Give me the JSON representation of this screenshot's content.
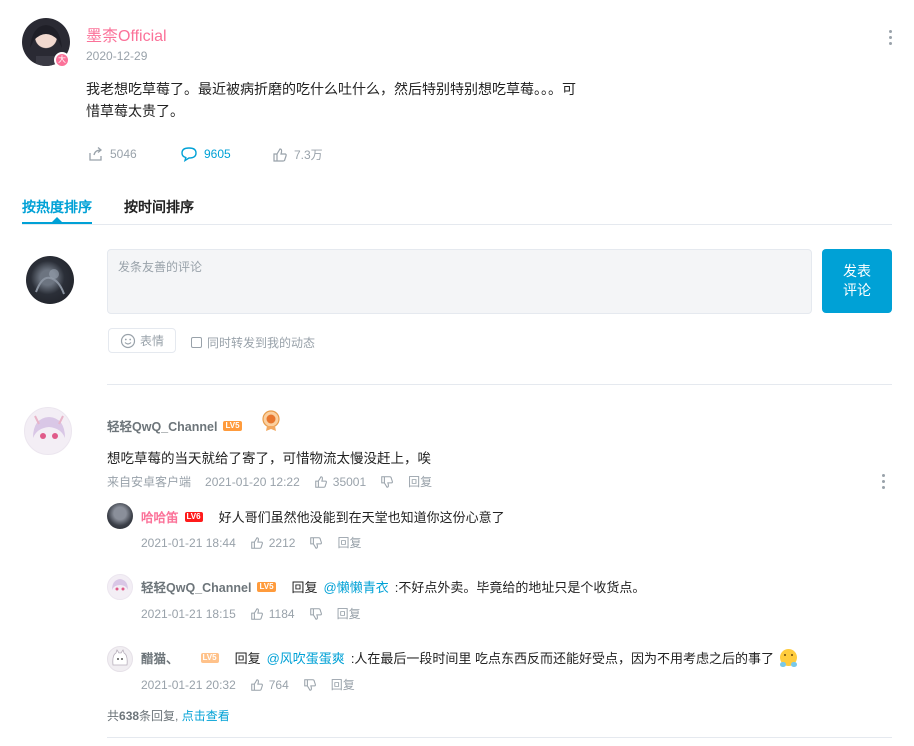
{
  "post": {
    "author": "墨柰Official",
    "date": "2020-12-29",
    "text_line1": "我老想吃草莓了。最近被病折磨的吃什么吐什么，然后特别特别想吃草莓。。。可",
    "text_line2": "惜草莓太贵了。",
    "share_count": "5046",
    "comment_count": "9605",
    "like_count": "7.3万"
  },
  "tabs": [
    {
      "label": "按热度排序",
      "active": true
    },
    {
      "label": "按时间排序",
      "active": false
    }
  ],
  "composer": {
    "placeholder": "发条友善的评论",
    "submit_line1": "发表",
    "submit_line2": "评论",
    "emoji_label": "表情",
    "repost_label": "同时转发到我的动态"
  },
  "comment": {
    "user": "轻轻QwQ_Channel",
    "level": "LV5",
    "text": "想吃草莓的当天就给了寄了，可惜物流太慢没赶上，唉",
    "source": "来自安卓客户端",
    "time": "2021-01-20 12:22",
    "likes": "35001",
    "reply_label": "回复"
  },
  "replies": [
    {
      "user": "哈哈笛",
      "level": "LV6",
      "prefix": "",
      "mention": "",
      "text": "好人哥们虽然他没能到在天堂也知道你这份心意了",
      "time": "2021-01-21 18:44",
      "likes": "2212",
      "reply_label": "回复"
    },
    {
      "user": "轻轻QwQ_Channel",
      "level": "LV5",
      "prefix": "回复",
      "mention": "@懒懒青衣",
      "text": ":不好点外卖。毕竟给的地址只是个收货点。",
      "time": "2021-01-21 18:15",
      "likes": "1184",
      "reply_label": "回复"
    },
    {
      "user": "醋猫、",
      "level": "LV5",
      "prefix": "回复",
      "mention": "@风吹蛋蛋爽",
      "text": ":人在最后一段时间里 吃点东西反而还能好受点，因为不用考虑之后的事了",
      "time": "2021-01-21 20:32",
      "likes": "764",
      "reply_label": "回复"
    }
  ],
  "more_replies": {
    "prefix": "共",
    "count": "638",
    "suffix": "条回复,",
    "link": "点击查看"
  },
  "colors": {
    "accent": "#00a1d6",
    "author_pink": "#fb7299",
    "muted": "#99a2aa"
  }
}
